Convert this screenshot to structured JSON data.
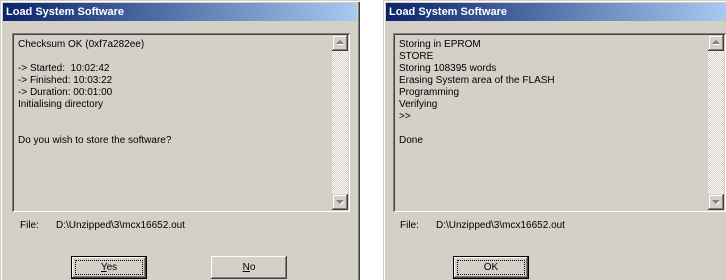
{
  "colors": {
    "title_gradient_start": "#0a246a",
    "title_gradient_end": "#a6caf0",
    "dialog_face": "#d4d0c8"
  },
  "icons": {
    "scroll_up": "scroll-up-arrow-icon",
    "scroll_down": "scroll-down-arrow-icon"
  },
  "dialogs": [
    {
      "title": "Load System Software",
      "log_text": "Checksum OK (0xf7a282ee)\n\n-> Started:  10:02:42\n-> Finished: 10:03:22\n-> Duration: 00:01:00\nInitialising directory\n\n\nDo you wish to store the software?",
      "scrollbar_disabled": true,
      "file": {
        "label": "File:",
        "path": "D:\\Unzipped\\3\\mcx16652.out"
      },
      "buttons": [
        {
          "label": "Yes",
          "accelerator": "Y",
          "default": true,
          "focused": true
        },
        {
          "label": "No",
          "accelerator": "N",
          "default": false,
          "focused": false
        }
      ]
    },
    {
      "title": "Load System Software",
      "log_text": "Storing in EPROM\nSTORE\nStoring 108395 words\nErasing System area of the FLASH\nProgramming\nVerifying\n>>\n\nDone",
      "scrollbar_disabled": true,
      "file": {
        "label": "File:",
        "path": "D:\\Unzipped\\3\\mcx16652.out"
      },
      "buttons": [
        {
          "label": "OK",
          "default": true,
          "focused": true
        }
      ]
    }
  ]
}
